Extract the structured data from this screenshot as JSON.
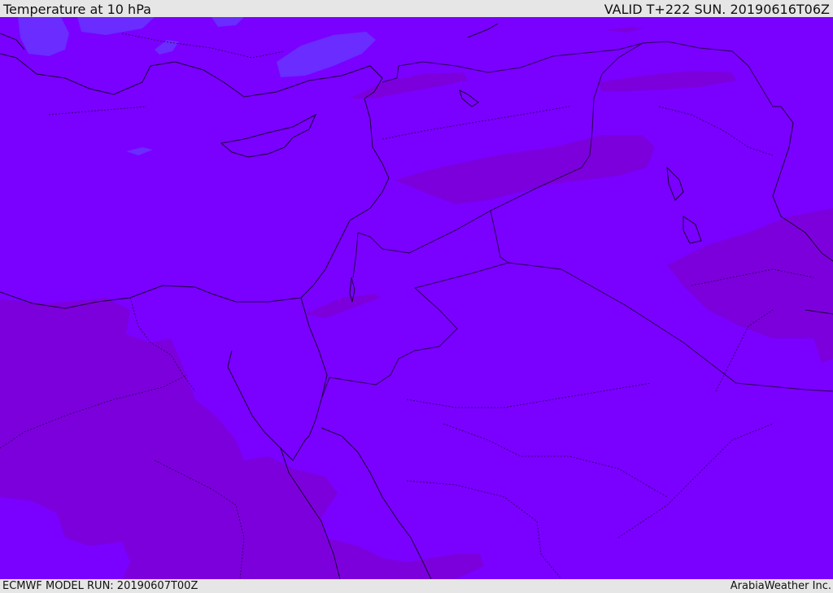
{
  "header": {
    "title": "Temperature at 10 hPa",
    "valid": "VALID T+222 SUN. 20190616T06Z"
  },
  "footer": {
    "model_run": "ECMWF MODEL RUN: 20190607T00Z",
    "credit": "ArabiaWeather Inc."
  },
  "map": {
    "colors": {
      "field_base": "#7a00ff",
      "field_warm": "#7d00dd",
      "field_cool": "#6a2cff",
      "coastline": "#1a0033",
      "border": "#2a0050"
    }
  }
}
